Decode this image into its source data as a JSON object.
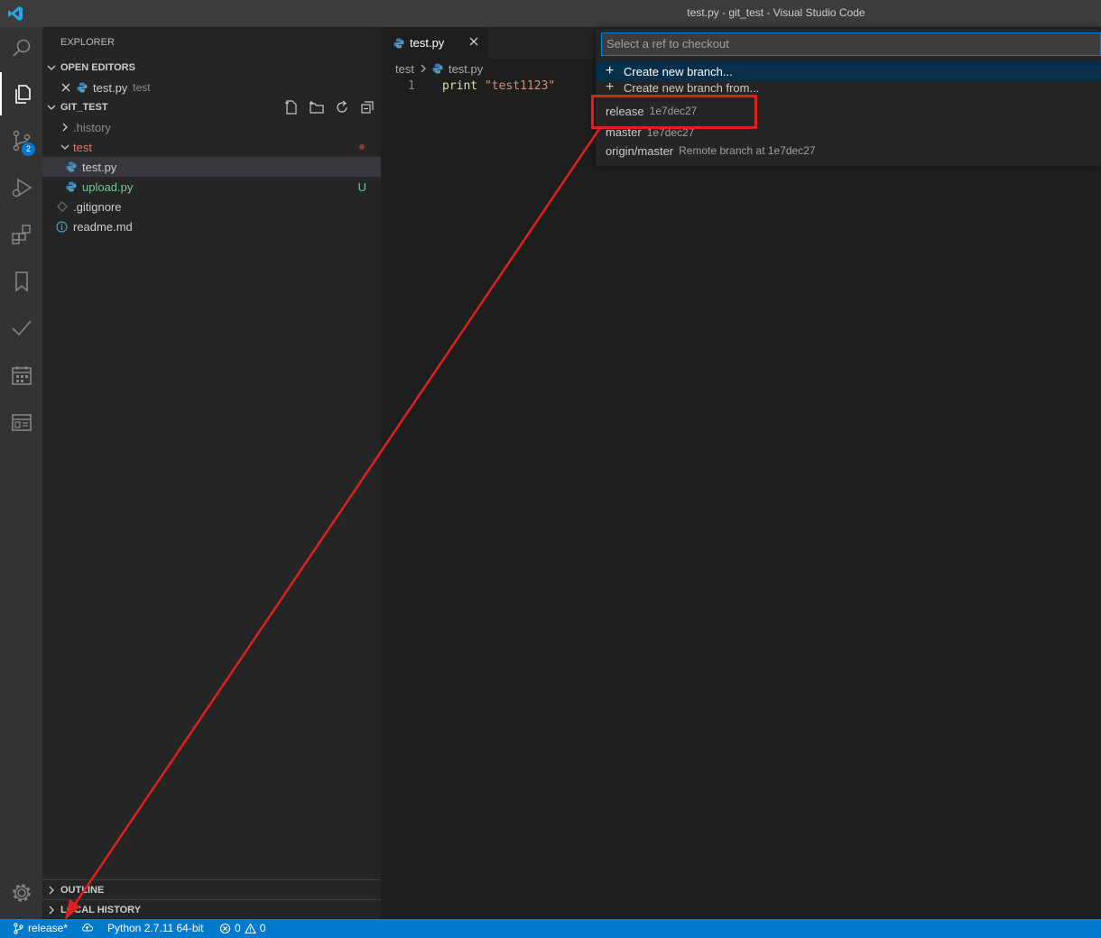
{
  "window": {
    "title": "test.py - git_test - Visual Studio Code"
  },
  "activity_bar": {
    "icons": [
      "search-icon",
      "files-icon",
      "source-control-icon",
      "run-debug-icon",
      "extensions-icon",
      "bookmarks-icon",
      "checkmark-icon",
      "calendar-icon",
      "board-icon",
      "gear-icon"
    ],
    "scm_badge": "2"
  },
  "sidebar": {
    "title": "EXPLORER",
    "open_editors": {
      "header": "OPEN EDITORS",
      "items": [
        {
          "name": "test.py",
          "folder": "test"
        }
      ]
    },
    "workspace": {
      "header": "GIT_TEST",
      "items": [
        {
          "name": ".history",
          "type": "folder",
          "expanded": false
        },
        {
          "name": "test",
          "type": "folder",
          "expanded": true,
          "status_dot": true
        },
        {
          "name": "test.py",
          "type": "file"
        },
        {
          "name": "upload.py",
          "type": "file",
          "status": "U"
        },
        {
          "name": ".gitignore",
          "type": "file"
        },
        {
          "name": "readme.md",
          "type": "file"
        }
      ]
    },
    "outline_header": "OUTLINE",
    "local_history_header": "LOCAL HISTORY"
  },
  "editor": {
    "tab_label": "test.py",
    "breadcrumb": {
      "folder": "test",
      "file": "test.py"
    },
    "lines": [
      {
        "number": "1",
        "keyword": "print",
        "string": "\"test1123\""
      }
    ]
  },
  "quick_pick": {
    "placeholder": "Select a ref to checkout",
    "items": [
      {
        "label": "Create new branch...",
        "icon": "plus-icon"
      },
      {
        "label": "Create new branch from...",
        "icon": "plus-icon"
      },
      {
        "label": "release",
        "description": "1e7dec27"
      },
      {
        "label": "master",
        "description": "1e7dec27"
      },
      {
        "label": "origin/master",
        "description": "Remote branch at 1e7dec27"
      }
    ]
  },
  "status_bar": {
    "branch": "release*",
    "python": "Python 2.7.11 64-bit",
    "errors": "0",
    "warnings": "0"
  },
  "colors": {
    "accent": "#007acc",
    "annotation": "#e02020",
    "untracked": "#73c991",
    "modified_folder": "#e2786a"
  }
}
